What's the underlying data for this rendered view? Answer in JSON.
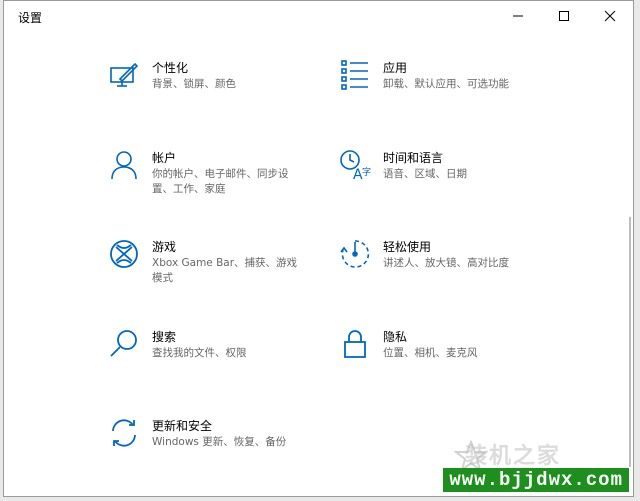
{
  "window": {
    "title": "设置"
  },
  "accent": "#0067c0",
  "items": [
    {
      "title": "个性化",
      "desc": "背景、锁屏、颜色",
      "icon": "personalization-icon"
    },
    {
      "title": "应用",
      "desc": "卸载、默认应用、可选功能",
      "icon": "apps-icon"
    },
    {
      "title": "帐户",
      "desc": "你的帐户、电子邮件、同步设置、工作、家庭",
      "icon": "accounts-icon"
    },
    {
      "title": "时间和语言",
      "desc": "语音、区域、日期",
      "icon": "time-language-icon"
    },
    {
      "title": "游戏",
      "desc": "Xbox Game Bar、捕获、游戏模式",
      "icon": "gaming-icon"
    },
    {
      "title": "轻松使用",
      "desc": "讲述人、放大镜、高对比度",
      "icon": "ease-of-access-icon"
    },
    {
      "title": "搜索",
      "desc": "查找我的文件、权限",
      "icon": "search-icon"
    },
    {
      "title": "隐私",
      "desc": "位置、相机、麦克风",
      "icon": "privacy-lock-icon"
    },
    {
      "title": "更新和安全",
      "desc": "Windows 更新、恢复、备份",
      "icon": "update-security-icon"
    }
  ],
  "watermark": {
    "logo_text": "装机之家",
    "url": "www.bjjdwx.com"
  }
}
